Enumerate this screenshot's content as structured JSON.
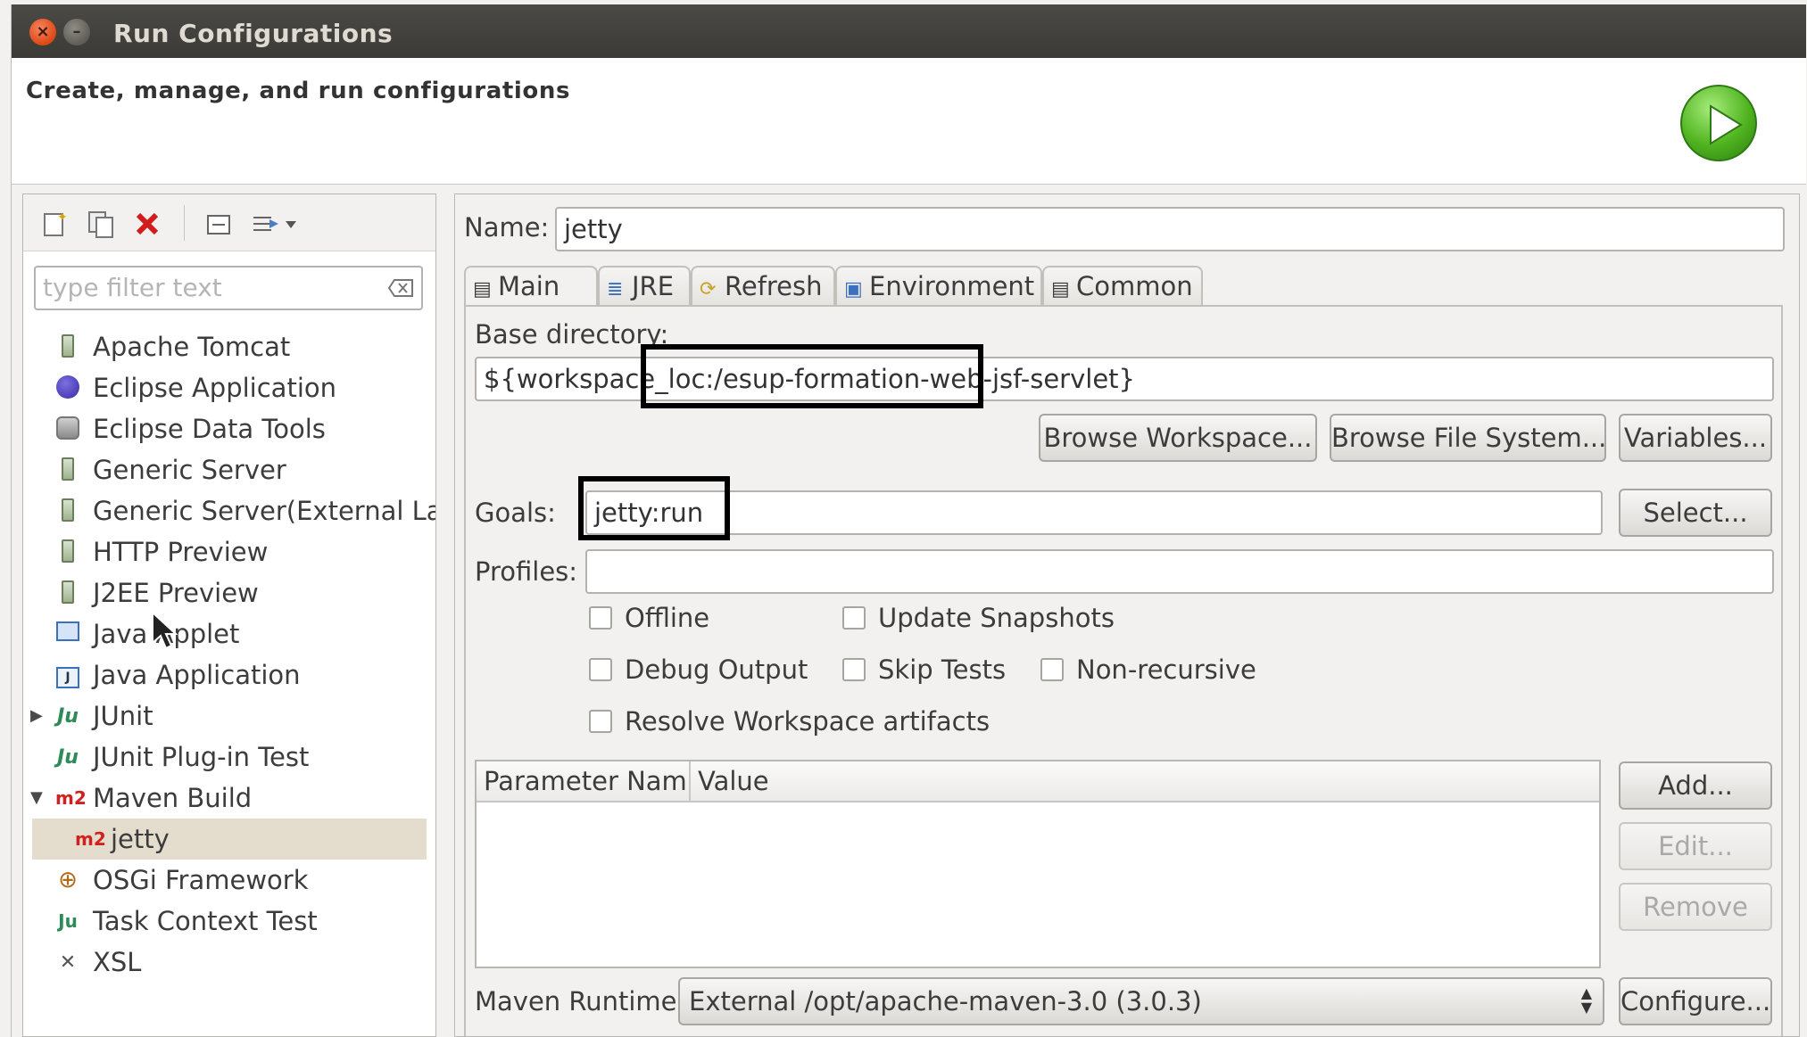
{
  "window": {
    "title": "Run Configurations",
    "banner_text": "Create, manage, and run configurations"
  },
  "left_toolbar": {
    "icons": [
      "new-config-icon",
      "duplicate-config-icon",
      "delete-config-icon",
      "collapse-all-icon",
      "filter-menu-icon"
    ]
  },
  "filter": {
    "placeholder": "type filter text"
  },
  "tree": {
    "items": [
      {
        "label": "Apache Tomcat",
        "icon": "server-icon"
      },
      {
        "label": "Eclipse Application",
        "icon": "eclipse-icon"
      },
      {
        "label": "Eclipse Data Tools",
        "icon": "database-icon"
      },
      {
        "label": "Generic Server",
        "icon": "server-icon"
      },
      {
        "label": "Generic Server(External Lau",
        "icon": "server-icon"
      },
      {
        "label": "HTTP Preview",
        "icon": "server-icon"
      },
      {
        "label": "J2EE Preview",
        "icon": "server-icon"
      },
      {
        "label": "Java Applet",
        "icon": "java-applet-icon"
      },
      {
        "label": "Java Application",
        "icon": "java-application-icon"
      },
      {
        "label": "JUnit",
        "icon": "junit-icon",
        "expander": "▶"
      },
      {
        "label": "JUnit Plug-in Test",
        "icon": "junit-plugin-icon"
      },
      {
        "label": "Maven Build",
        "icon": "maven-icon",
        "expander": "▼",
        "icon_text": "m2"
      },
      {
        "label": "jetty",
        "icon": "maven-icon",
        "icon_text": "m2",
        "selected": true
      },
      {
        "label": "OSGi Framework",
        "icon": "osgi-icon"
      },
      {
        "label": "Task Context Test",
        "icon": "task-context-icon"
      },
      {
        "label": "XSL",
        "icon": "xsl-icon"
      }
    ]
  },
  "config": {
    "name_label": "Name:",
    "name_value": "jetty",
    "tabs": [
      {
        "label": "Main",
        "icon": "main-tab-icon",
        "active": true
      },
      {
        "label": "JRE",
        "icon": "jre-tab-icon"
      },
      {
        "label": "Refresh",
        "icon": "refresh-tab-icon"
      },
      {
        "label": "Environment",
        "icon": "environment-tab-icon"
      },
      {
        "label": "Common",
        "icon": "common-tab-icon"
      }
    ],
    "base_dir_label": "Base directory:",
    "base_dir_value": "${workspace_loc:/esup-formation-web-jsf-servlet}",
    "browse_workspace": "Browse Workspace...",
    "browse_fs": "Browse File System...",
    "variables": "Variables...",
    "goals_label": "Goals:",
    "goals_value": "jetty:run",
    "select_button": "Select...",
    "profiles_label": "Profiles:",
    "profiles_value": "",
    "checkboxes": {
      "offline": "Offline",
      "update_snapshots": "Update Snapshots",
      "debug_output": "Debug Output",
      "skip_tests": "Skip Tests",
      "non_recursive": "Non-recursive",
      "resolve_workspace": "Resolve Workspace artifacts"
    },
    "param_table": {
      "columns": [
        "Parameter Nam",
        "Value"
      ]
    },
    "add_button": "Add...",
    "edit_button": "Edit...",
    "remove_button": "Remove",
    "runtime_label": "Maven Runtime:",
    "runtime_value": "External /opt/apache-maven-3.0 (3.0.3)",
    "configure_button": "Configure..."
  }
}
